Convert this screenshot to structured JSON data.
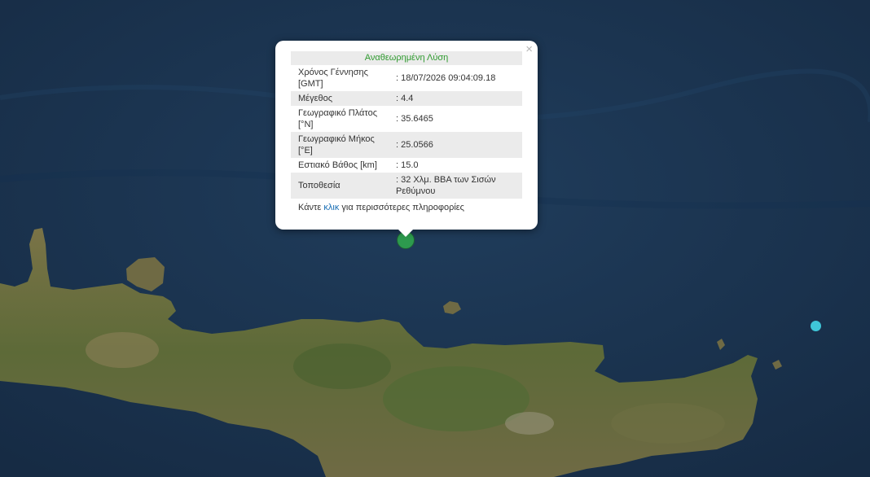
{
  "popup": {
    "title": "Αναθεωρημένη Λύση",
    "close_symbol": "×",
    "rows": [
      {
        "label": "Χρόνος Γέννησης [GMT]",
        "value": ": 18/07/2026 09:04:09.18"
      },
      {
        "label": "Μέγεθος",
        "value": ": 4.4"
      },
      {
        "label": "Γεωγραφικό Πλάτος [°N]",
        "value": ": 35.6465"
      },
      {
        "label": "Γεωγραφικό Μήκος [°E]",
        "value": ": 25.0566"
      },
      {
        "label": "Εστιακό Βάθος [km]",
        "value": ": 15.0"
      },
      {
        "label": "Τοποθεσία",
        "value": ": 32 Χλμ. ΒΒΑ των Σισών Ρεθύμνου"
      }
    ],
    "more_prefix": "Κάντε ",
    "more_link": "κλικ",
    "more_suffix": " για περισσότερες πληροφορίες"
  },
  "markers": {
    "main_color": "#2d9a4e",
    "secondary_color": "#3fc6d8"
  },
  "colors": {
    "sea": "#1b3350",
    "land": "#6b6a3e",
    "land_green": "#4f6a34",
    "title_green": "#2e9a2e",
    "link": "#1a6fb5"
  }
}
